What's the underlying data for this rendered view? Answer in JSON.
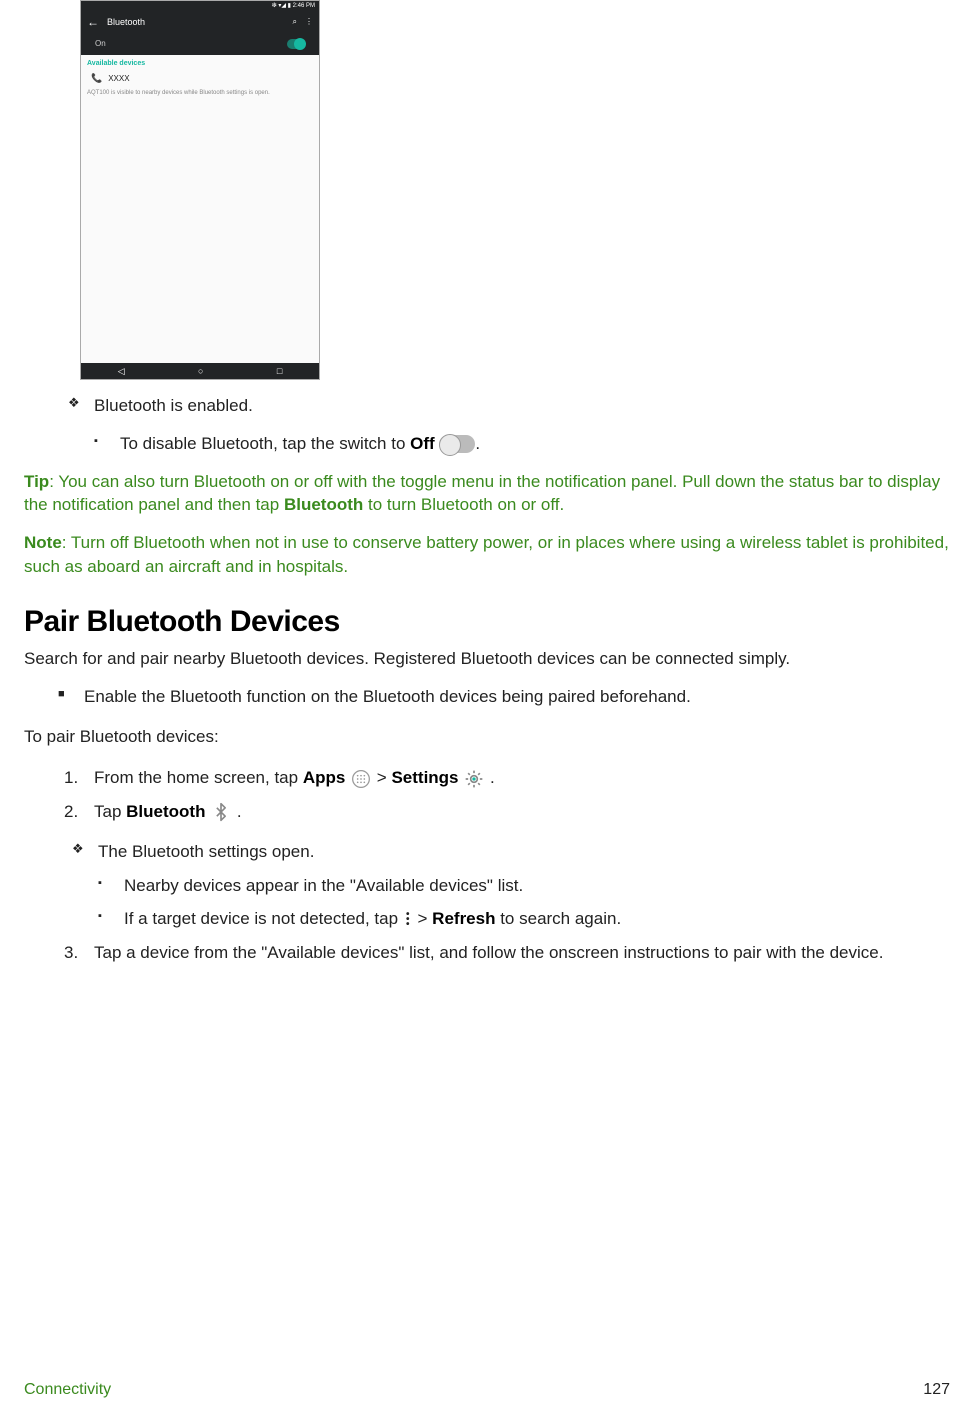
{
  "screenshot": {
    "status_time": "❇ ▾◢ ▮ 2:46 PM",
    "back_icon": "←",
    "title": "Bluetooth",
    "search_icon": "🔍",
    "menu_icon": "⋮",
    "toggle_label": "On",
    "section_label": "Available devices",
    "device_row": "XXXX",
    "visibility_note": "AQT100 is visible to nearby devices while Bluetooth settings is open.",
    "nav_back": "◁",
    "nav_home": "○",
    "nav_recent": "□"
  },
  "bullets": {
    "enabled": "Bluetooth is enabled.",
    "disable_pre": "To disable Bluetooth, tap the switch to ",
    "disable_bold": "Off",
    "disable_post": "."
  },
  "tip": {
    "label": "Tip",
    "text_a": ": You can also turn Bluetooth on or off with the toggle menu in the notification panel. Pull down the status bar to display the notification panel and then tap ",
    "bold": "Bluetooth",
    "text_b": " to turn Bluetooth on or off."
  },
  "note": {
    "label": "Note",
    "text": ": Turn off Bluetooth when not in use to conserve battery power, or in places where using a wireless tablet is prohibited, such as aboard an aircraft and in hospitals."
  },
  "heading": "Pair Bluetooth Devices",
  "lead": "Search for and pair nearby Bluetooth devices. Registered Bluetooth devices can be connected simply.",
  "pre_enable": "Enable the Bluetooth function on the Bluetooth devices being paired beforehand.",
  "to_pair": "To pair Bluetooth devices:",
  "steps": {
    "s1_a": "From the home screen, tap ",
    "s1_apps": "Apps",
    "s1_gt": " > ",
    "s1_settings": "Settings",
    "s1_end": " .",
    "s2_a": "Tap ",
    "s2_bt": "Bluetooth",
    "s2_end": " .",
    "s2_result": "The Bluetooth settings open.",
    "s2_sub1": "Nearby devices appear in the \"Available devices\" list.",
    "s2_sub2_a": "If a target device is not detected, tap ",
    "s2_sub2_gt": " > ",
    "s2_sub2_refresh": "Refresh",
    "s2_sub2_b": " to search again.",
    "s3": "Tap a device from the \"Available devices\" list, and follow the onscreen instructions to pair with the device."
  },
  "footer": {
    "section": "Connectivity",
    "page": "127"
  }
}
